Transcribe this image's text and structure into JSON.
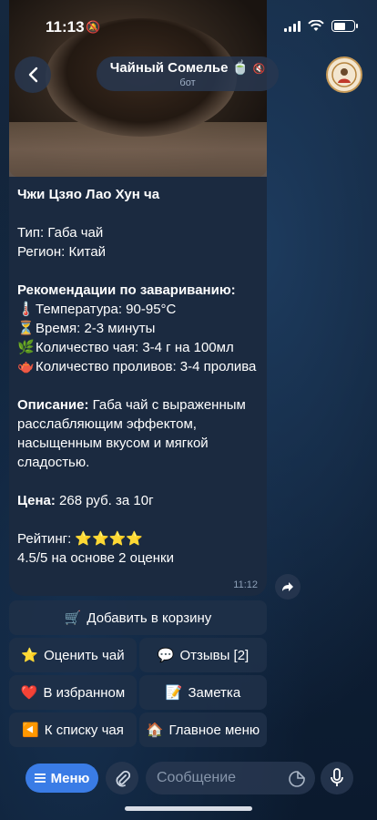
{
  "status_bar": {
    "time": "11:13"
  },
  "header": {
    "title": "Чайный Сомелье 🍵",
    "subtitle": "бот"
  },
  "message": {
    "tea_name": "Чжи Цзяо Лао Хун ча",
    "type_line": "Тип: Габа чай",
    "region_line": "Регион: Китай",
    "brewing_title": "Рекомендации по завариванию:",
    "temp_emoji": "🌡️",
    "temp_line": "Температура: 90-95°C",
    "time_emoji": "⏳",
    "time_line": "Время: 2-3 минуты",
    "amount_emoji": "🌿",
    "amount_line": "Количество чая: 3-4 г на 100мл",
    "infusions_emoji": "🫖",
    "infusions_line": "Количество проливов: 3-4 пролива",
    "description_label": "Описание:",
    "description_text": " Габа чай с выраженным расслабляющим эффектом, насыщенным вкусом и мягкой сладостью.",
    "price_label": "Цена:",
    "price_text": " 268 руб. за 10г",
    "rating_label": "Рейтинг: ",
    "rating_stars": "⭐⭐⭐⭐",
    "rating_value": 4,
    "rating_summary": "4.5/5 на основе 2 оценки",
    "sent_time": "11:12"
  },
  "keyboard": {
    "add_to_cart": {
      "icon": "🛒",
      "label": "Добавить в корзину"
    },
    "rate_tea": {
      "icon": "⭐",
      "label": "Оценить чай"
    },
    "reviews": {
      "icon": "💬",
      "label": "Отзывы [2]"
    },
    "favorites": {
      "icon": "❤️",
      "label": "В избранном"
    },
    "note": {
      "icon": "📝",
      "label": "Заметка"
    },
    "back_to_list": {
      "icon": "◀️",
      "label": "К списку чая"
    },
    "main_menu": {
      "icon": "🏠",
      "label": "Главное меню"
    }
  },
  "input_bar": {
    "menu_label": "Меню",
    "placeholder": "Сообщение"
  },
  "colors": {
    "accent": "#3a7ce6",
    "bubble": "#1b2a40",
    "button_bg": "#1e3048"
  }
}
